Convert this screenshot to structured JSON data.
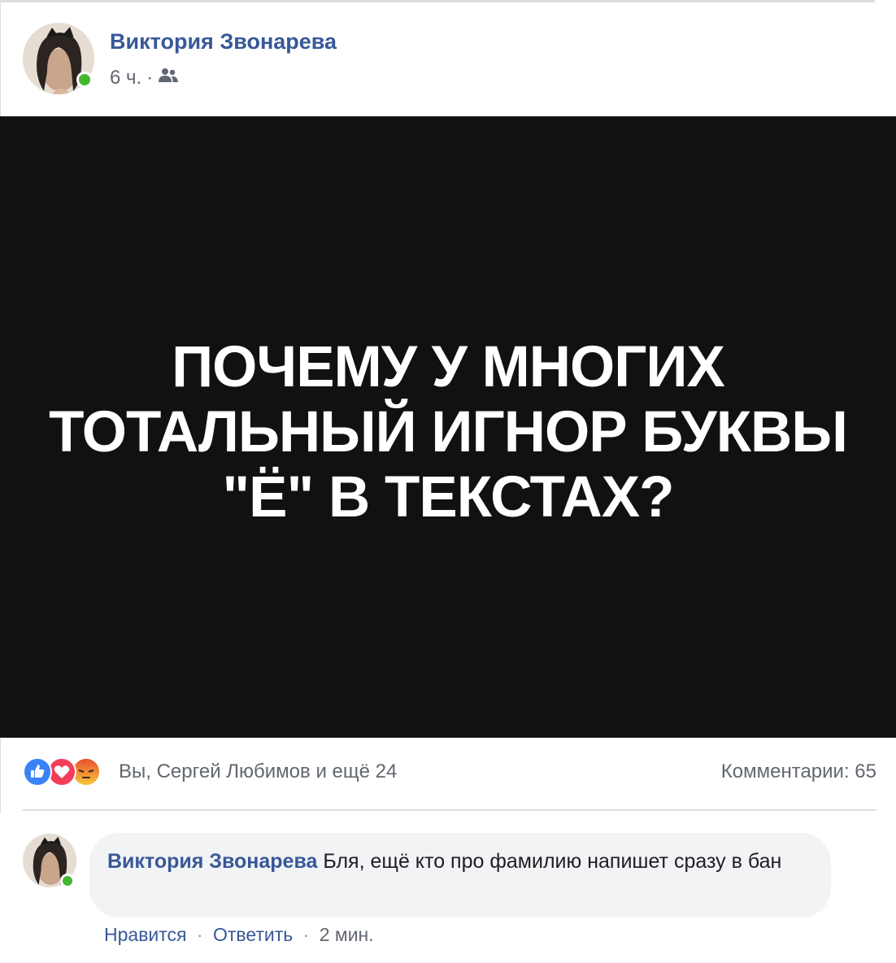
{
  "post": {
    "author": "Виктория Звонарева",
    "time": "6 ч.",
    "separator": "·",
    "audience_icon": "friends-icon",
    "headline_lines": [
      "ПОЧЕМУ У МНОГИХ",
      "ТОТАЛЬНЫЙ ИГНОР БУКВЫ",
      "\"Ё\" В ТЕКСТАХ?"
    ]
  },
  "reactions": {
    "icons": [
      "like-icon",
      "love-icon",
      "angry-icon"
    ],
    "summary": "Вы, Сергей Любимов и ещё 24",
    "comments_count": "Комментарии: 65"
  },
  "comment": {
    "author": "Виктория Звонарева",
    "text": "Бля, ещё кто про фамилию напишет сразу в бан",
    "like_label": "Нравится",
    "reply_label": "Ответить",
    "time": "2 мин.",
    "separator": "·"
  },
  "colors": {
    "link": "#385898",
    "meta": "#616770",
    "online": "#44b72e",
    "image_bg": "#111111",
    "bubble": "#f2f3f5"
  }
}
